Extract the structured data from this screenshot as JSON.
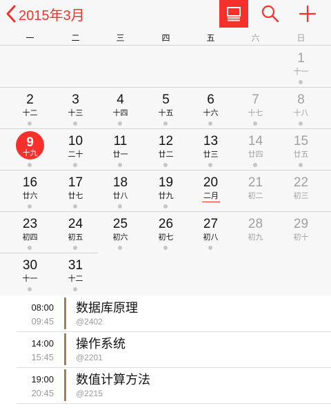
{
  "header": {
    "month_label": "2015年3月",
    "accent": "#f6312b"
  },
  "icons": {
    "back": "chevron-left-icon",
    "list_view": "list-view-icon",
    "search": "search-icon",
    "add": "plus-icon"
  },
  "weekdays": [
    "一",
    "二",
    "三",
    "四",
    "五",
    "六",
    "日"
  ],
  "calendar": {
    "weeks": [
      [
        null,
        null,
        null,
        null,
        null,
        null,
        {
          "day": "1",
          "lunar": "十一",
          "dot": true
        }
      ],
      [
        {
          "day": "2",
          "lunar": "十二",
          "dot": true
        },
        {
          "day": "3",
          "lunar": "十三",
          "dot": true
        },
        {
          "day": "4",
          "lunar": "十四",
          "dot": true
        },
        {
          "day": "5",
          "lunar": "十五",
          "dot": true
        },
        {
          "day": "6",
          "lunar": "十六",
          "dot": true
        },
        {
          "day": "7",
          "lunar": "十七",
          "dot": true
        },
        {
          "day": "8",
          "lunar": "十八",
          "dot": true
        }
      ],
      [
        {
          "day": "9",
          "lunar": "十九",
          "dot": true,
          "selected": true
        },
        {
          "day": "10",
          "lunar": "二十",
          "dot": true
        },
        {
          "day": "11",
          "lunar": "廿一",
          "dot": true
        },
        {
          "day": "12",
          "lunar": "廿二",
          "dot": true
        },
        {
          "day": "13",
          "lunar": "廿三",
          "dot": true
        },
        {
          "day": "14",
          "lunar": "廿四",
          "dot": true
        },
        {
          "day": "15",
          "lunar": "廿五",
          "dot": true
        }
      ],
      [
        {
          "day": "16",
          "lunar": "廿六",
          "dot": true
        },
        {
          "day": "17",
          "lunar": "廿七",
          "dot": true
        },
        {
          "day": "18",
          "lunar": "廿八",
          "dot": true
        },
        {
          "day": "19",
          "lunar": "廿九",
          "dot": true
        },
        {
          "day": "20",
          "lunar": "二月",
          "dot": false,
          "today": true
        },
        {
          "day": "21",
          "lunar": "初二",
          "dot": false
        },
        {
          "day": "22",
          "lunar": "初三",
          "dot": false
        }
      ],
      [
        {
          "day": "23",
          "lunar": "初四",
          "dot": true
        },
        {
          "day": "24",
          "lunar": "初五",
          "dot": true
        },
        {
          "day": "25",
          "lunar": "初六",
          "dot": true
        },
        {
          "day": "26",
          "lunar": "初七",
          "dot": true
        },
        {
          "day": "27",
          "lunar": "初八",
          "dot": true
        },
        {
          "day": "28",
          "lunar": "初九",
          "dot": false
        },
        {
          "day": "29",
          "lunar": "初十",
          "dot": false
        }
      ],
      [
        {
          "day": "30",
          "lunar": "十一",
          "dot": true
        },
        {
          "day": "31",
          "lunar": "十二",
          "dot": true
        },
        null,
        null,
        null,
        null,
        null
      ]
    ]
  },
  "events": [
    {
      "start": "08:00",
      "end": "09:45",
      "title": "数据库原理",
      "location": "@2402",
      "color": "#9d8054"
    },
    {
      "start": "14:00",
      "end": "15:45",
      "title": "操作系统",
      "location": "@2201",
      "color": "#9d8054"
    },
    {
      "start": "19:00",
      "end": "20:45",
      "title": "数值计算方法",
      "location": "@2215",
      "color": "#9d8054"
    }
  ]
}
